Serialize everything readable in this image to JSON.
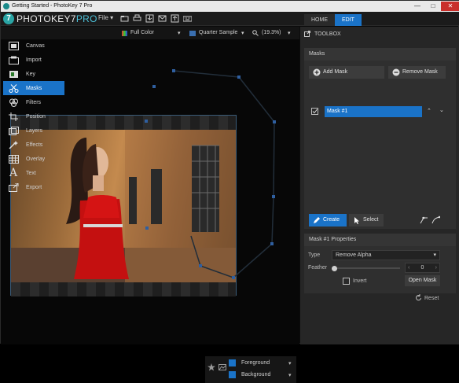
{
  "window": {
    "title": "Getting Started - PhotoKey 7 Pro",
    "controls": {
      "minimize": "—",
      "maximize": "□",
      "close": "✕"
    }
  },
  "menubar": {
    "logo_main": "PHOTOKEY7",
    "logo_sub": "PRO",
    "file_menu": "File ▾",
    "toolbar_icons": [
      "open-icon",
      "print-icon",
      "import-icon",
      "mail-icon",
      "export-icon",
      "keyboard-icon"
    ]
  },
  "tabs": [
    {
      "label": "HOME",
      "active": false
    },
    {
      "label": "EDIT",
      "active": true
    }
  ],
  "viewbar": {
    "color_mode": "Full Color",
    "sample": "Quarter Sample",
    "zoom": "(19.3%)"
  },
  "nav": [
    {
      "label": "Canvas",
      "icon": "canvas-icon",
      "active": false
    },
    {
      "label": "Import",
      "icon": "import-icon",
      "active": false
    },
    {
      "label": "Key",
      "icon": "key-icon",
      "active": false
    },
    {
      "label": "Masks",
      "icon": "scissors-icon",
      "active": true
    },
    {
      "label": "Filters",
      "icon": "filters-icon",
      "active": false
    },
    {
      "label": "Position",
      "icon": "crop-icon",
      "active": false
    },
    {
      "label": "Layers",
      "icon": "layers-icon",
      "active": false
    },
    {
      "label": "Effects",
      "icon": "wand-icon",
      "active": false
    },
    {
      "label": "Overlay",
      "icon": "grid-icon",
      "active": false
    },
    {
      "label": "Text",
      "icon": "text-icon",
      "active": false
    },
    {
      "label": "Export",
      "icon": "export-icon",
      "active": false
    }
  ],
  "toolbox": {
    "title": "TOOLBOX",
    "masks_panel": {
      "header": "Masks",
      "add_mask": "Add Mask",
      "remove_mask": "Remove Mask",
      "selected_mask": "Mask #1",
      "create": "Create",
      "select": "Select"
    },
    "properties": {
      "header": "Mask #1 Properties",
      "type_label": "Type",
      "type_value": "Remove Alpha",
      "feather_label": "Feather",
      "feather_value": "0",
      "feather_level": 0,
      "invert": "Invert",
      "open_mask": "Open Mask"
    },
    "reset": "Reset"
  },
  "layers_strip": {
    "foreground": "Foreground",
    "background": "Background"
  },
  "colors": {
    "accent": "#1a73c8",
    "panel": "#2f2f2f",
    "dark": "#0b0b0b"
  }
}
